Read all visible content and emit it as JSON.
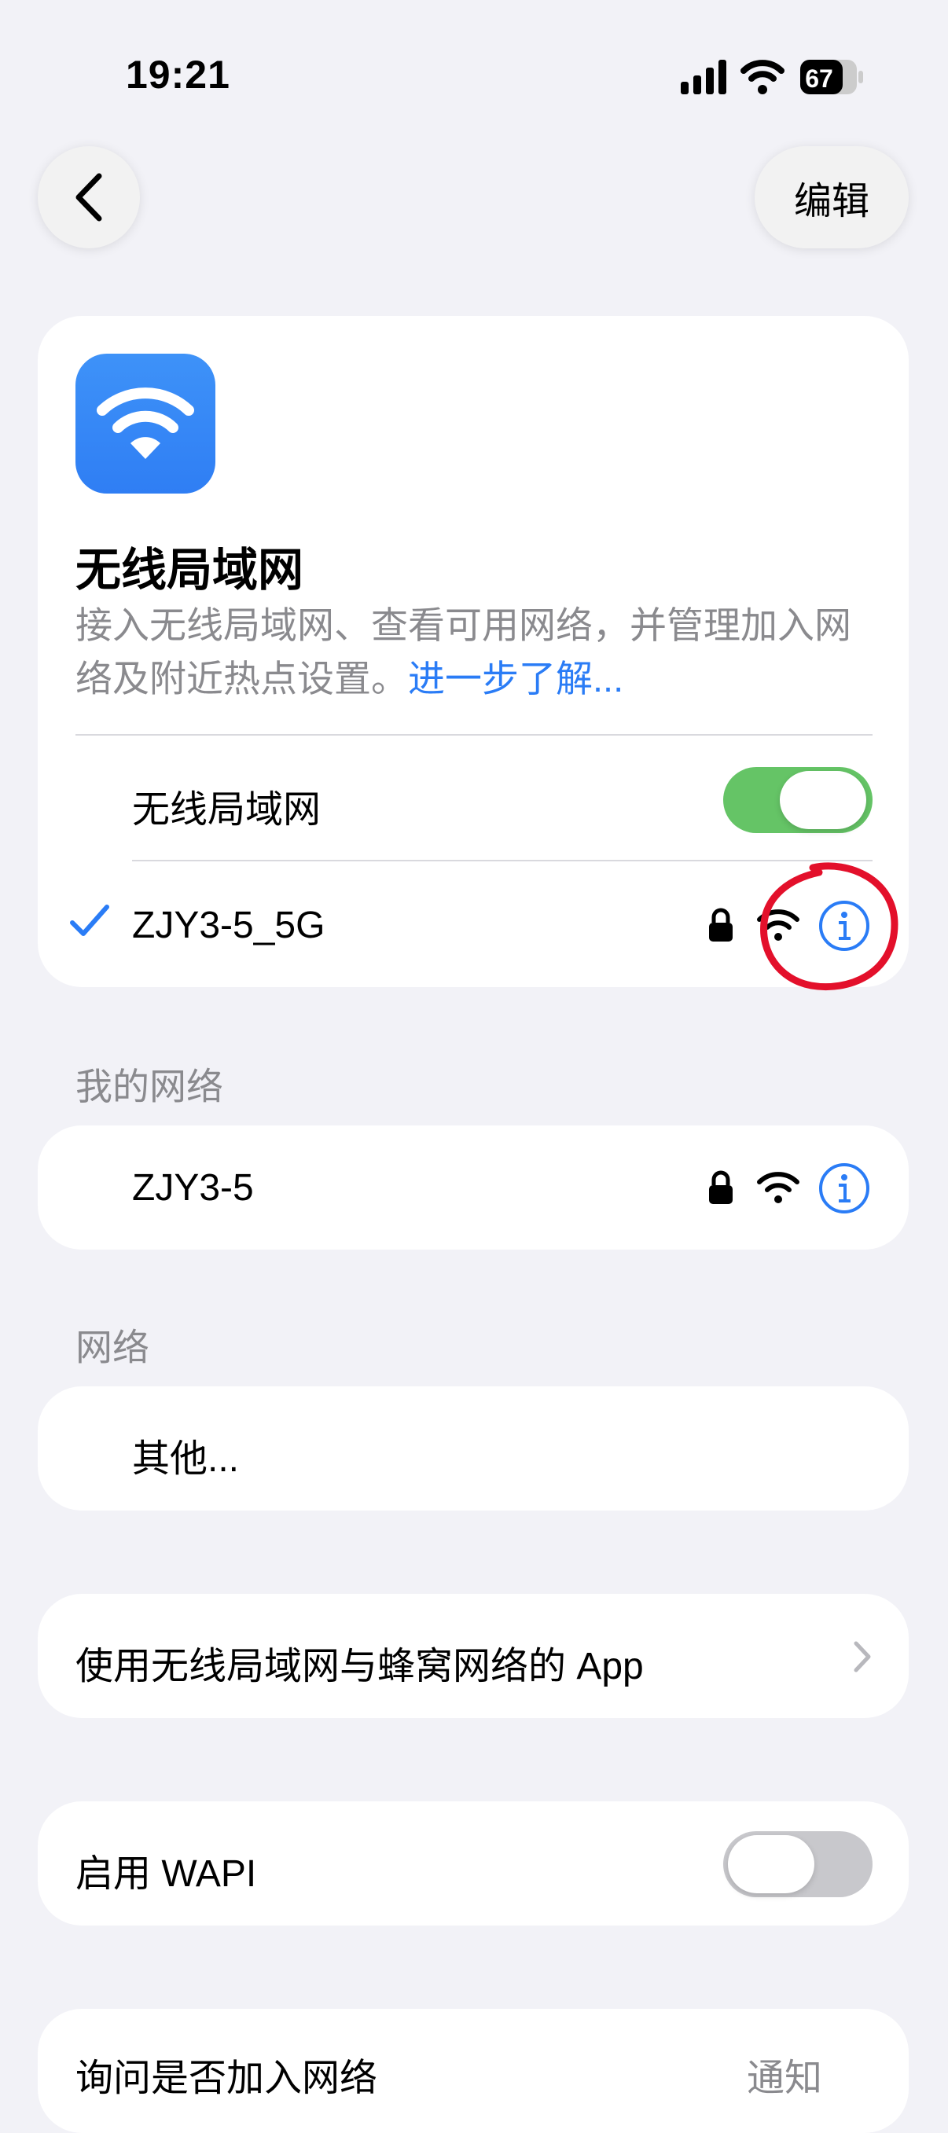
{
  "status_bar": {
    "time": "19:21",
    "battery": "67"
  },
  "nav": {
    "edit_label": "编辑"
  },
  "hero": {
    "title": "无线局域网",
    "description": "接入无线局域网、查看可用网络，并管理加入网络及附近热点设置。",
    "learn_more": "进一步了解..."
  },
  "wifi_toggle": {
    "label": "无线局域网",
    "state": "on"
  },
  "connected_network": {
    "name": "ZJY3-5_5G",
    "secured": true
  },
  "my_networks": {
    "header": "我的网络",
    "items": [
      {
        "name": "ZJY3-5",
        "secured": true
      }
    ]
  },
  "networks": {
    "header": "网络",
    "other_label": "其他..."
  },
  "apps_row": {
    "label": "使用无线局域网与蜂窝网络的 App"
  },
  "wapi": {
    "label": "启用 WAPI",
    "state": "off"
  },
  "ask_join": {
    "label": "询问是否加入网络",
    "value": "通知"
  },
  "colors": {
    "accent": "#2a7cf6",
    "toggle_on": "#65c466",
    "annotation": "#e3102b"
  }
}
